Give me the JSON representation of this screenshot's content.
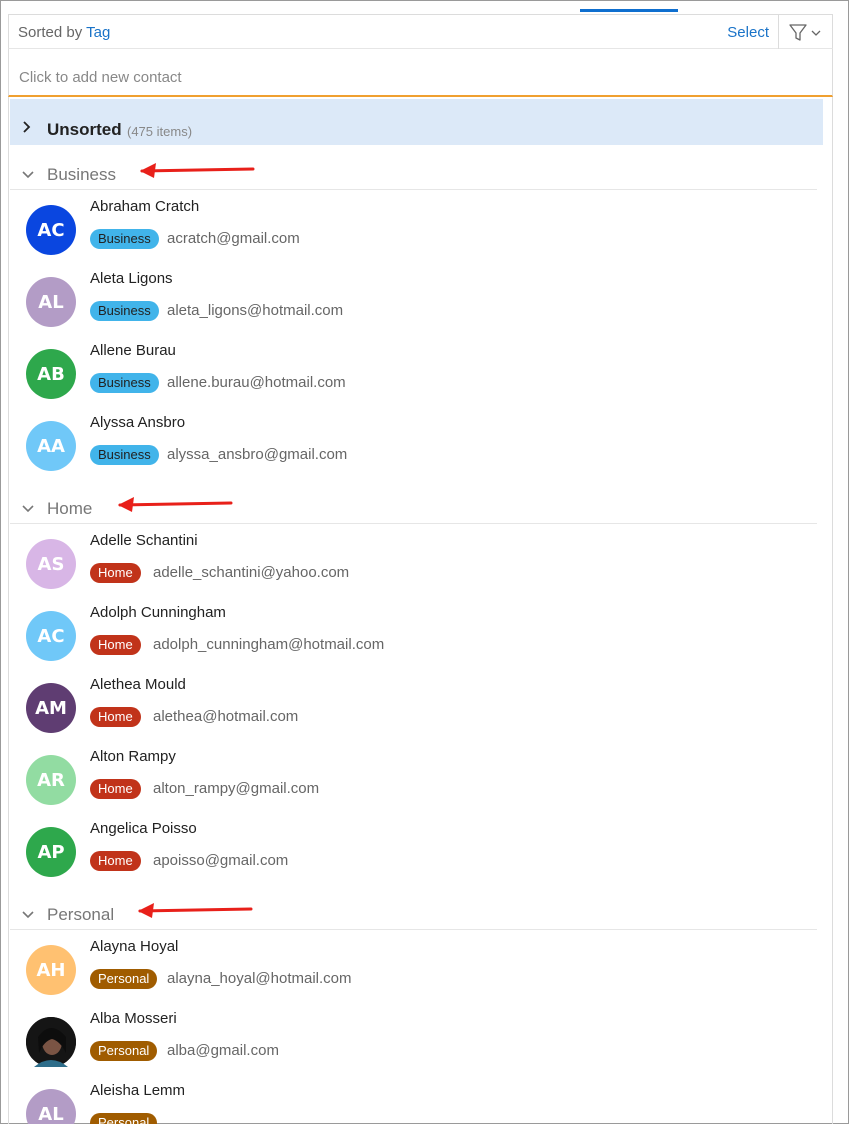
{
  "toolbar": {
    "sorted_prefix": "Sorted by",
    "sorted_value": "Tag",
    "select_label": "Select",
    "filter_icon": "filter-icon"
  },
  "add_contact": {
    "placeholder": "Click to add new contact"
  },
  "unsorted": {
    "title": "Unsorted",
    "count": "(475 items)"
  },
  "groups": [
    {
      "title": "Business",
      "tag_color": "#41b4ea",
      "contacts": [
        {
          "initials": "AC",
          "name": "Abraham Cratch",
          "tag": "Business",
          "email": "acratch@gmail.com",
          "color": "#0a46e0"
        },
        {
          "initials": "AL",
          "name": "Aleta Ligons",
          "tag": "Business",
          "email": "aleta_ligons@hotmail.com",
          "color": "#b39cc6"
        },
        {
          "initials": "AB",
          "name": "Allene Burau",
          "tag": "Business",
          "email": "allene.burau@hotmail.com",
          "color": "#2ea84c"
        },
        {
          "initials": "AA",
          "name": "Alyssa Ansbro",
          "tag": "Business",
          "email": "alyssa_ansbro@gmail.com",
          "color": "#70c8f8"
        }
      ]
    },
    {
      "title": "Home",
      "tag_color": "#c1331a",
      "contacts": [
        {
          "initials": "AS",
          "name": "Adelle Schantini",
          "tag": "Home",
          "email": "adelle_schantini@yahoo.com",
          "color": "#d8b6e6"
        },
        {
          "initials": "AC",
          "name": "Adolph Cunningham",
          "tag": "Home",
          "email": "adolph_cunningham@hotmail.com",
          "color": "#70c8f8"
        },
        {
          "initials": "AM",
          "name": "Alethea Mould",
          "tag": "Home",
          "email": "alethea@hotmail.com",
          "color": "#5f3d72"
        },
        {
          "initials": "AR",
          "name": "Alton Rampy",
          "tag": "Home",
          "email": "alton_rampy@gmail.com",
          "color": "#92dca2"
        },
        {
          "initials": "AP",
          "name": "Angelica Poisso",
          "tag": "Home",
          "email": "apoisso@gmail.com",
          "color": "#2ea84c"
        }
      ]
    },
    {
      "title": "Personal",
      "tag_color": "#a05c00",
      "contacts": [
        {
          "initials": "AH",
          "name": "Alayna Hoyal",
          "tag": "Personal",
          "email": "alayna_hoyal@hotmail.com",
          "color": "#ffc171"
        },
        {
          "initials": "",
          "name": "Alba Mosseri",
          "tag": "Personal",
          "email": "alba@gmail.com",
          "color": "#1b1b1b",
          "photo": true
        },
        {
          "initials": "AL",
          "name": "Aleisha Lemm",
          "tag": "Personal",
          "email": "",
          "color": "#b39cc6"
        }
      ]
    }
  ]
}
